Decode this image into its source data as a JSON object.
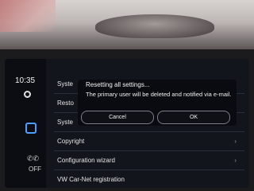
{
  "sidebar": {
    "clock": "10:35",
    "status_off": "OFF"
  },
  "menu": {
    "items": [
      {
        "label": "Syste"
      },
      {
        "label": "Resto"
      },
      {
        "label": "Syste"
      },
      {
        "label": "Copyright"
      },
      {
        "label": "Configuration wizard"
      },
      {
        "label": "VW Car-Net registration"
      }
    ]
  },
  "dialog": {
    "title": "Resetting all settings...",
    "message": "The primary user will be deleted and notified via e-mail.",
    "cancel_label": "Cancel",
    "ok_label": "OK"
  },
  "colors": {
    "accent": "#4aa0ff",
    "screen_bg": "#13151c",
    "dialog_bg": "#0a0b10"
  },
  "icons": [
    "gear-icon",
    "square-icon",
    "phone-icon",
    "chevron-right-icon"
  ]
}
